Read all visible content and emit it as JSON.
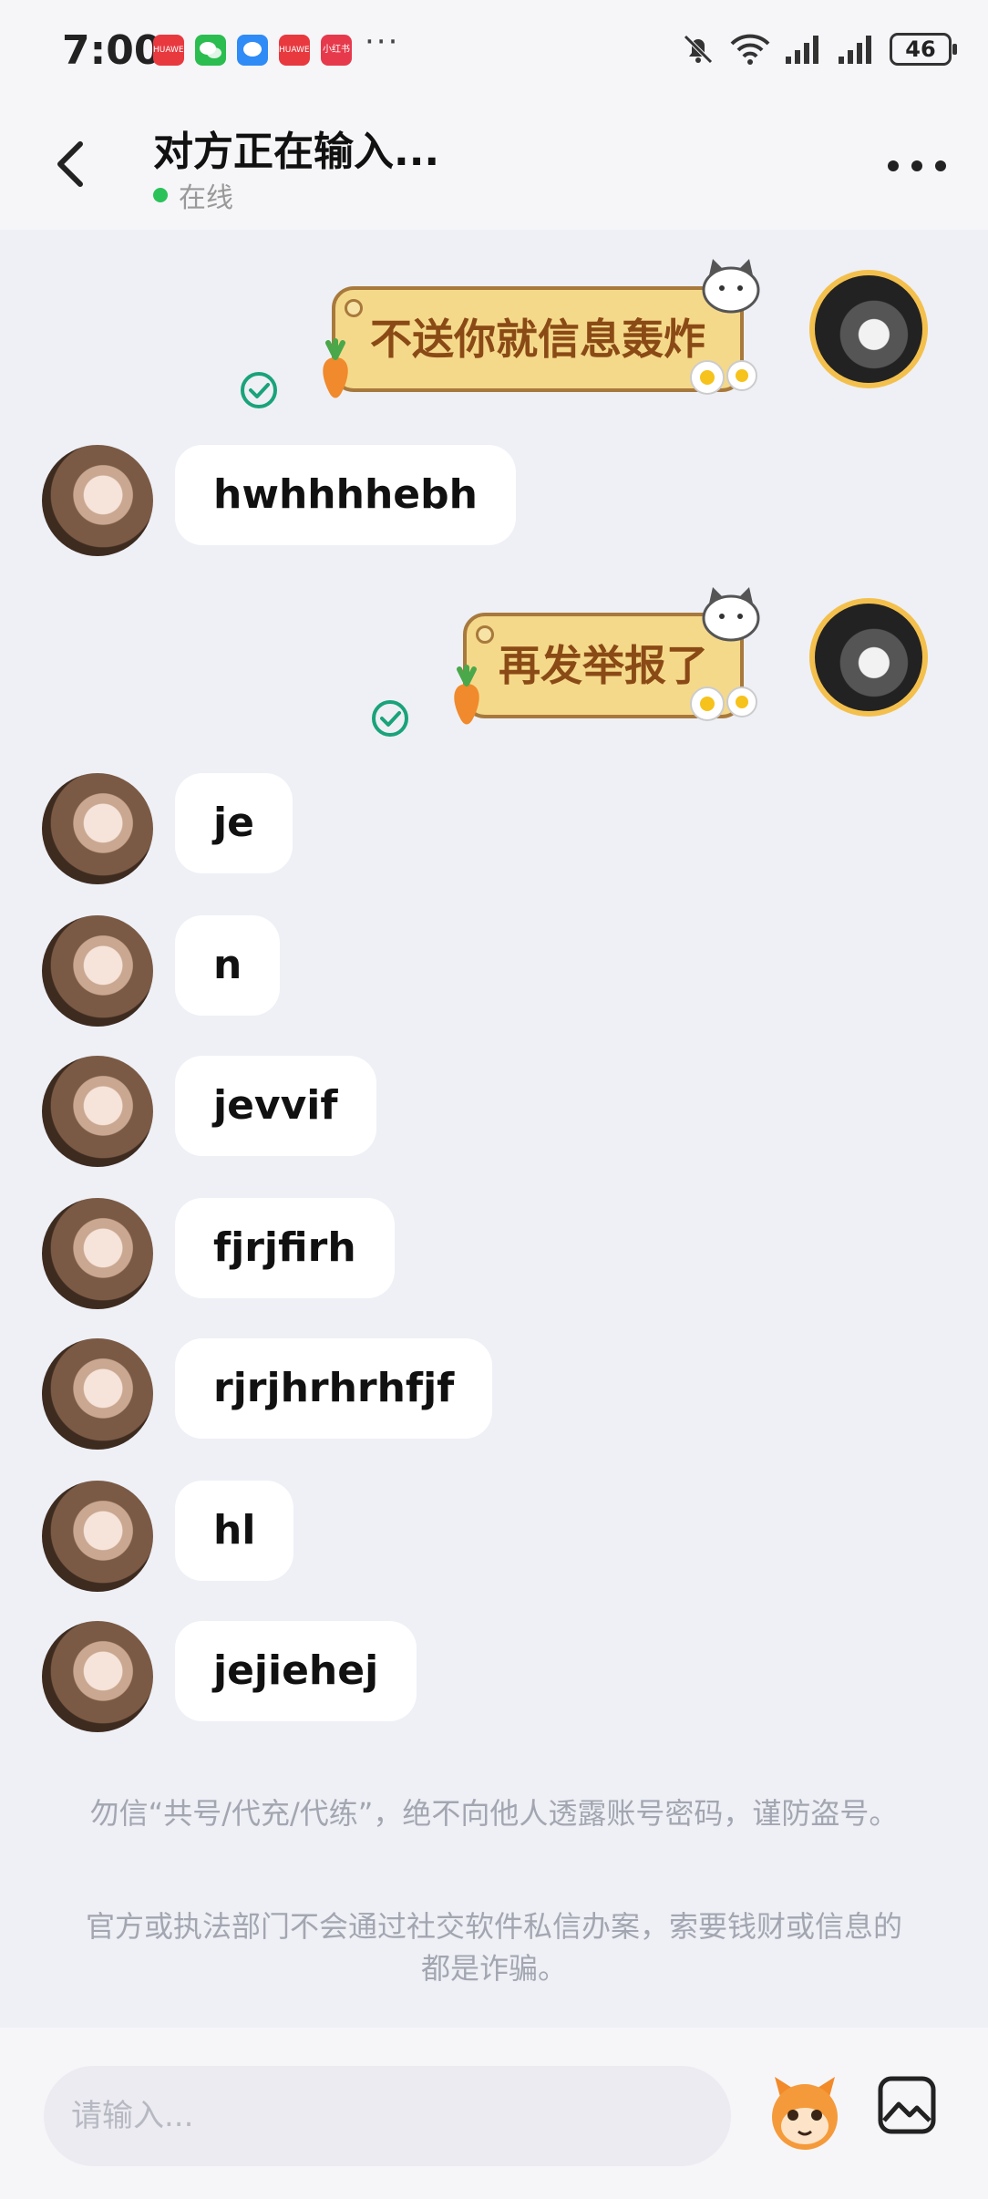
{
  "status_bar": {
    "time": "7:00",
    "battery": "46",
    "apps": [
      {
        "icon": "huawei-app-icon",
        "color": "#e8393f",
        "label": "HUAWEI"
      },
      {
        "icon": "wechat-icon",
        "color": "#2bbd4f",
        "label": ""
      },
      {
        "icon": "message-icon",
        "color": "#2f8bf5",
        "label": ""
      },
      {
        "icon": "huawei-app-icon",
        "color": "#e8393f",
        "label": "HUAWEI"
      },
      {
        "icon": "app-icon",
        "color": "#e63a4c",
        "label": "小红书"
      }
    ],
    "more": "···"
  },
  "header": {
    "title": "对方正在输入...",
    "status": "在线",
    "status_color": "#2bc25a"
  },
  "messages": [
    {
      "from": "self",
      "type": "card",
      "text": "不送你就信息轰炸",
      "read": true
    },
    {
      "from": "friend",
      "type": "text",
      "text": "hwhhhhebh"
    },
    {
      "from": "self",
      "type": "card",
      "text": "再发举报了",
      "read": true
    },
    {
      "from": "friend",
      "type": "text",
      "text": "je"
    },
    {
      "from": "friend",
      "type": "text",
      "text": "n"
    },
    {
      "from": "friend",
      "type": "text",
      "text": "jevvif"
    },
    {
      "from": "friend",
      "type": "text",
      "text": "fjrjfirh"
    },
    {
      "from": "friend",
      "type": "text",
      "text": "rjrjhrhrhfjf"
    },
    {
      "from": "friend",
      "type": "text",
      "text": "hl"
    },
    {
      "from": "friend",
      "type": "text",
      "text": "jejiehej"
    }
  ],
  "notice": {
    "line1": "勿信“共号/代充/代练”，绝不向他人透露账号密码，谨防盗号。",
    "line2": "官方或执法部门不会通过社交软件私信办案，索要钱财或信息的都是诈骗。"
  },
  "input": {
    "placeholder": "请输入..."
  },
  "colors": {
    "background": "#eef0f6",
    "bubble": "#ffffff",
    "card_fill": "#f5d98a",
    "card_text": "#8a4a16",
    "read_check": "#1aa37a"
  }
}
